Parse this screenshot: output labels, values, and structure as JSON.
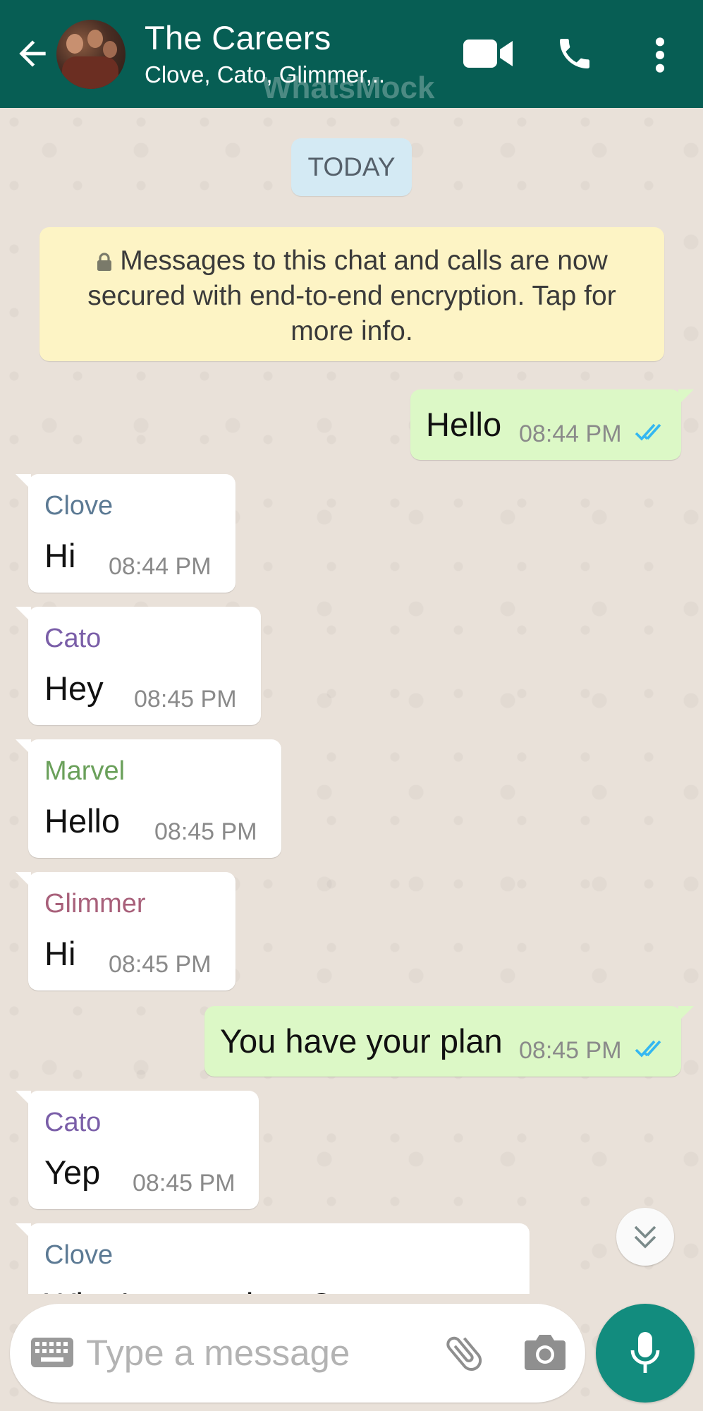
{
  "header": {
    "title": "The Careers",
    "subtitle": "Clove, Cato, Glimmer,..",
    "watermark": "WhatsMock",
    "bg_color": "#075e54"
  },
  "date_chip": "TODAY",
  "encryption_notice": "Messages to this chat and calls are now secured with end-to-end encryption. Tap for more info.",
  "messages": [
    {
      "dir": "out",
      "text": "Hello",
      "time": "08:44 PM",
      "status": "read"
    },
    {
      "dir": "in",
      "sender": "Clove",
      "sender_color": "#5c7a94",
      "text": "Hi",
      "time": "08:44 PM"
    },
    {
      "dir": "in",
      "sender": "Cato",
      "sender_color": "#7a5ea8",
      "text": "Hey",
      "time": "08:45 PM"
    },
    {
      "dir": "in",
      "sender": "Marvel",
      "sender_color": "#6aa05a",
      "text": "Hello",
      "time": "08:45 PM"
    },
    {
      "dir": "in",
      "sender": "Glimmer",
      "sender_color": "#a8607a",
      "text": "Hi",
      "time": "08:45 PM"
    },
    {
      "dir": "out",
      "text": "You have your plan",
      "time": "08:45 PM",
      "status": "read"
    },
    {
      "dir": "in",
      "sender": "Cato",
      "sender_color": "#7a5ea8",
      "text": "Yep",
      "time": "08:45 PM"
    },
    {
      "dir": "in",
      "sender": "Clove",
      "sender_color": "#5c7a94",
      "text": "What's your plan, Cato",
      "time": ""
    }
  ],
  "input": {
    "placeholder": "Type a message"
  },
  "icons": {
    "back": "arrow-left-icon",
    "video": "video-call-icon",
    "phone": "phone-call-icon",
    "menu": "more-vert-icon",
    "keyboard": "keyboard-icon",
    "attach": "paperclip-icon",
    "camera": "camera-icon",
    "mic": "microphone-icon",
    "scroll": "double-chevron-down-icon",
    "lock": "lock-icon",
    "ticks": "double-check-icon"
  },
  "colors": {
    "accent": "#128c7e",
    "outgoing_bubble": "#dcf8c6",
    "read_ticks": "#34b7f1",
    "encryption_bg": "#fdf4c5",
    "date_chip_bg": "#d4eaf4"
  }
}
